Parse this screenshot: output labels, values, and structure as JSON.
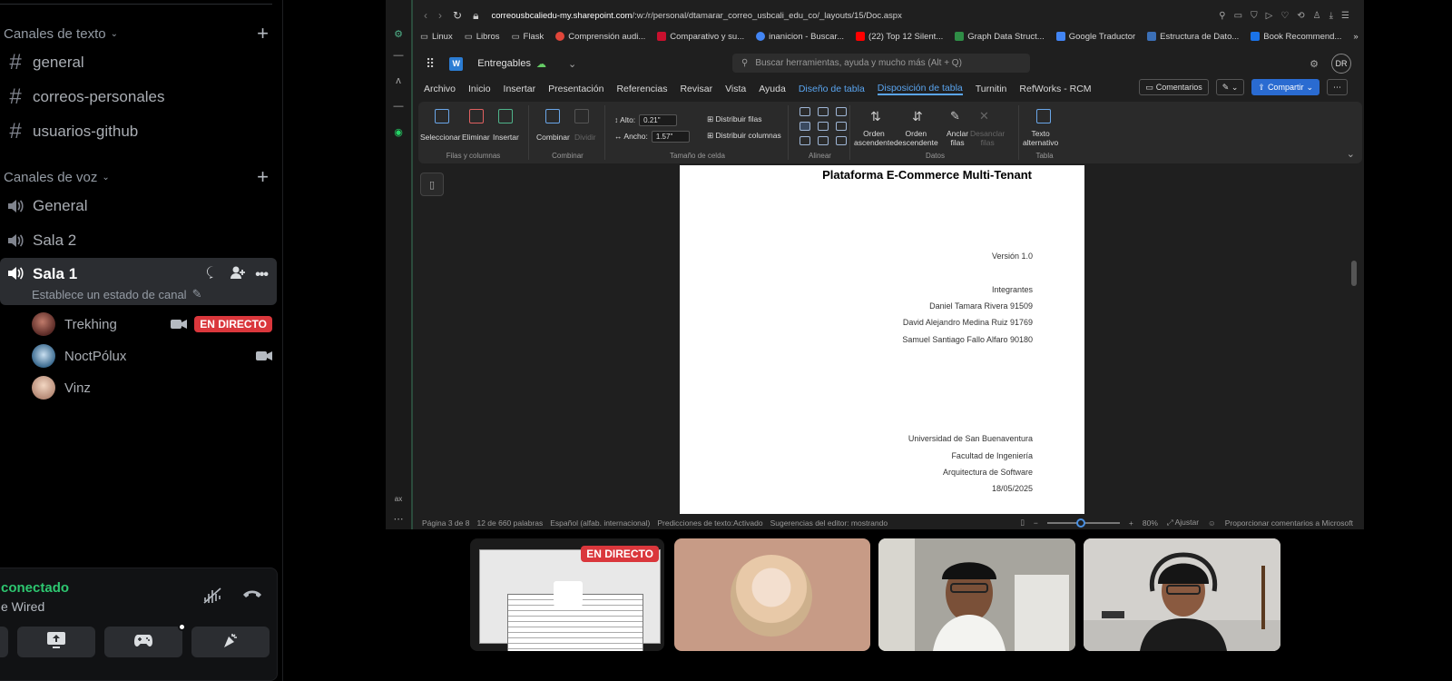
{
  "sidebar": {
    "text_channels_header": "Canales de texto",
    "text_channels": [
      {
        "name": "general"
      },
      {
        "name": "correos-personales"
      },
      {
        "name": "usuarios-github"
      }
    ],
    "voice_channels_header": "Canales de voz",
    "voice_channels": [
      {
        "name": "General"
      },
      {
        "name": "Sala 2"
      },
      {
        "name": "Sala 1",
        "status_placeholder": "Establece un estado de canal"
      }
    ],
    "participants": [
      {
        "name": "Trekhing",
        "live": "EN DIRECTO"
      },
      {
        "name": "NoctPólux"
      },
      {
        "name": "Vinz"
      }
    ]
  },
  "voice_panel": {
    "status": "conectado",
    "subtitle": "e Wired"
  },
  "browser": {
    "url_domain": "correousbcaliedu-my.sharepoint.com",
    "url_path": "/:w:/r/personal/dtamarar_correo_usbcali_edu_co/_layouts/15/Doc.aspx",
    "bookmarks": [
      {
        "label": "Linux",
        "color": "#bbbbbb"
      },
      {
        "label": "Libros",
        "color": "#bbbbbb"
      },
      {
        "label": "Flask",
        "color": "#bbbbbb"
      },
      {
        "label": "Comprensión audi...",
        "color": "#e0463a"
      },
      {
        "label": "Comparativo y su...",
        "color": "#c8102e"
      },
      {
        "label": "inanicion - Buscar...",
        "color": "#4285f4"
      },
      {
        "label": "(22) Top 12 Silent...",
        "color": "#ff0000"
      },
      {
        "label": "Graph Data Struct...",
        "color": "#2f8d46"
      },
      {
        "label": "Google Traductor",
        "color": "#4285f4"
      },
      {
        "label": "Estructura de Dato...",
        "color": "#3b6fb6"
      },
      {
        "label": "Book Recommend...",
        "color": "#1a73e8"
      }
    ]
  },
  "word": {
    "doc_name": "Entregables",
    "search_placeholder": "Buscar herramientas, ayuda y mucho más (Alt + Q)",
    "initials": "DR",
    "menus": [
      "Archivo",
      "Inicio",
      "Insertar",
      "Presentación",
      "Referencias",
      "Revisar",
      "Vista",
      "Ayuda",
      "Diseño de tabla",
      "Disposición de tabla",
      "Turnitin",
      "RefWorks - RCM"
    ],
    "comments_label": "Comentarios",
    "share_label": "Compartir",
    "ribbon": {
      "seleccionar": "Seleccionar",
      "eliminar": "Eliminar",
      "insertar": "Insertar",
      "group1": "Filas y columnas",
      "combinar": "Combinar",
      "dividir": "Dividir",
      "group2": "Combinar",
      "alto_label": "Alto:",
      "alto_value": "0.21\"",
      "ancho_label": "Ancho:",
      "ancho_value": "1.57\"",
      "distribuir_filas": "Distribuir filas",
      "distribuir_columnas": "Distribuir columnas",
      "group3": "Tamaño de celda",
      "group4": "Alinear",
      "orden_asc_1": "Orden",
      "orden_asc_2": "ascendente",
      "orden_desc_1": "Orden",
      "orden_desc_2": "descendente",
      "anclar_1": "Anclar",
      "anclar_2": "filas",
      "desanclar_1": "Desanclar",
      "desanclar_2": "filas",
      "group5": "Datos",
      "texto_1": "Texto",
      "texto_2": "alternativo",
      "group6": "Tabla"
    },
    "page": {
      "title": "Plataforma E-Commerce Multi-Tenant",
      "version": "Versión 1.0",
      "integrantes": "Integrantes",
      "members": [
        "Daniel Tamara Rivera 91509",
        "David Alejandro Medina Ruiz 91769",
        "Samuel Santiago Fallo Alfaro 90180"
      ],
      "institution": [
        "Universidad de San Buenaventura",
        "Facultad de Ingeniería",
        "Arquitectura de Software",
        "18/05/2025"
      ]
    },
    "status": {
      "page": "Página 3 de 8",
      "words": "12 de 660 palabras",
      "language": "Español (alfab. internacional)",
      "predictions": "Predicciones de texto:Activado",
      "suggestions": "Sugerencias del editor: mostrando",
      "zoom": "80%",
      "fit": "Ajustar",
      "feedback": "Proporcionar comentarios a Microsoft"
    }
  },
  "tiles": {
    "live_label": "EN DIRECTO"
  },
  "colors": {
    "live_red": "#da373c",
    "connected_green": "#2dc770",
    "word_accent": "#5aa5f0"
  }
}
